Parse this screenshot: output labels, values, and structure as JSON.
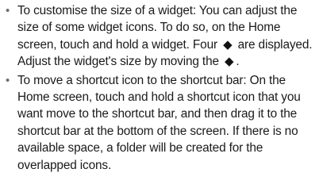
{
  "tips": [
    {
      "bullet": "•",
      "part1": "To customise the size of a widget: You can adjust the size of some widget icons. To do so, on the Home screen, touch and hold a widget. Four ",
      "icon": "◆",
      "part2": " are displayed. Adjust the widget's size by moving the ",
      "icon2": "◆",
      "part3": "."
    },
    {
      "bullet": "•",
      "text": "To move a shortcut icon to the shortcut bar: On the Home screen, touch and hold a shortcut icon that you want move to the shortcut bar, and then drag it to the shortcut bar at the bottom of the screen. If there is no available space, a folder will be created for the overlapped icons."
    }
  ]
}
